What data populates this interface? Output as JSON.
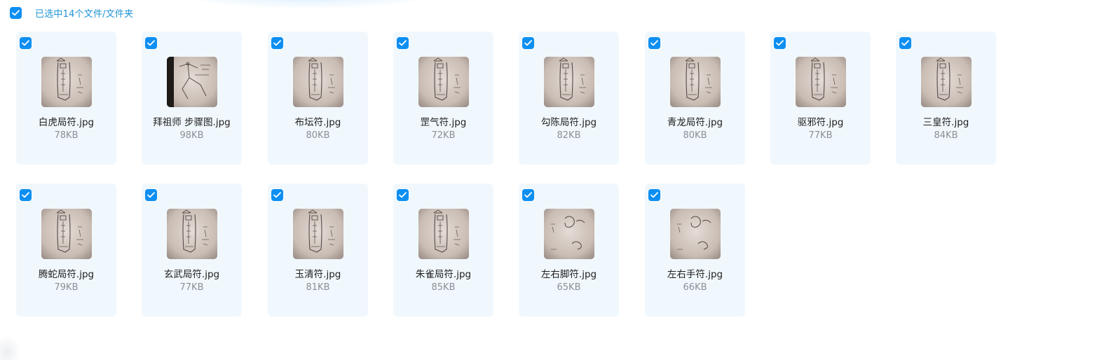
{
  "selection": {
    "checked": true,
    "label": "已选中14个文件/文件夹"
  },
  "files": [
    {
      "name": "白虎局符.jpg",
      "size": "78KB",
      "checked": true,
      "thumb": "talisman-sketch"
    },
    {
      "name": "拜祖师 步骤图.jpg",
      "size": "98KB",
      "checked": true,
      "thumb": "diagram-sketch"
    },
    {
      "name": "布坛符.jpg",
      "size": "80KB",
      "checked": true,
      "thumb": "talisman-sketch"
    },
    {
      "name": "罡气符.jpg",
      "size": "72KB",
      "checked": true,
      "thumb": "talisman-sketch"
    },
    {
      "name": "勾陈局符.jpg",
      "size": "82KB",
      "checked": true,
      "thumb": "talisman-sketch"
    },
    {
      "name": "青龙局符.jpg",
      "size": "80KB",
      "checked": true,
      "thumb": "talisman-sketch"
    },
    {
      "name": "驱邪符.jpg",
      "size": "77KB",
      "checked": true,
      "thumb": "talisman-sketch"
    },
    {
      "name": "三皇符.jpg",
      "size": "84KB",
      "checked": true,
      "thumb": "talisman-sketch"
    },
    {
      "name": "腾蛇局符.jpg",
      "size": "79KB",
      "checked": true,
      "thumb": "talisman-sketch"
    },
    {
      "name": "玄武局符.jpg",
      "size": "77KB",
      "checked": true,
      "thumb": "talisman-sketch"
    },
    {
      "name": "玉清符.jpg",
      "size": "81KB",
      "checked": true,
      "thumb": "talisman-sketch"
    },
    {
      "name": "朱雀局符.jpg",
      "size": "85KB",
      "checked": true,
      "thumb": "talisman-sketch"
    },
    {
      "name": "左右脚符.jpg",
      "size": "65KB",
      "checked": true,
      "thumb": "glyph-sketch"
    },
    {
      "name": "左右手符.jpg",
      "size": "66KB",
      "checked": true,
      "thumb": "glyph-sketch"
    }
  ],
  "colors": {
    "accent": "#0d8ff2",
    "card_bg": "#f1f8fd",
    "select_text": "#1f94d6",
    "size_text": "#8a8f96"
  }
}
